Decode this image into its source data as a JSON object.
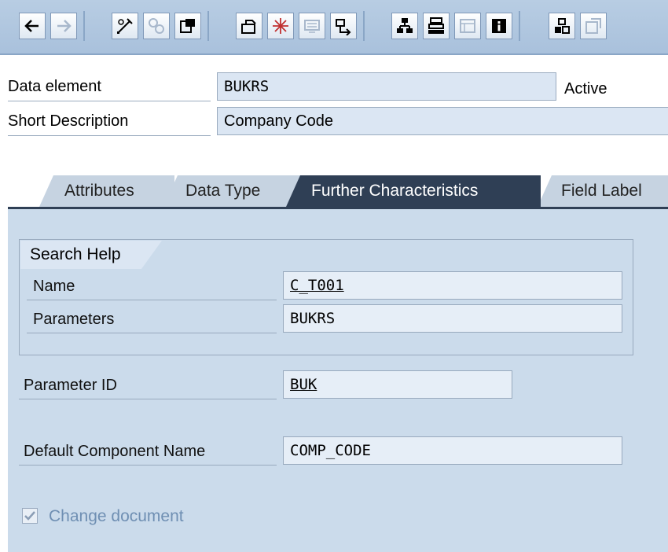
{
  "toolbar": {
    "buttons": [
      {
        "icon": "back-arrow-icon",
        "enabled": true
      },
      {
        "icon": "forward-arrow-icon",
        "enabled": false
      },
      {
        "icon": "display-change-icon",
        "enabled": true
      },
      {
        "icon": "active-inactive-icon",
        "enabled": false
      },
      {
        "icon": "other-object-icon",
        "enabled": true
      },
      {
        "icon": "check-icon",
        "enabled": true
      },
      {
        "icon": "activate-icon",
        "enabled": true
      },
      {
        "icon": "test-icon",
        "enabled": false
      },
      {
        "icon": "where-used-icon",
        "enabled": true
      },
      {
        "icon": "object-list-icon",
        "enabled": true
      },
      {
        "icon": "navigation-window-icon",
        "enabled": true
      },
      {
        "icon": "worklist-icon",
        "enabled": false
      },
      {
        "icon": "info-icon",
        "enabled": true
      },
      {
        "icon": "hierarchy-icon",
        "enabled": true
      },
      {
        "icon": "settings-icon",
        "enabled": false
      }
    ]
  },
  "header": {
    "data_element_label": "Data element",
    "data_element_value": "BUKRS",
    "status": "Active",
    "short_desc_label": "Short Description",
    "short_desc_value": "Company Code"
  },
  "tabs": [
    {
      "label": "Attributes",
      "active": false
    },
    {
      "label": "Data Type",
      "active": false
    },
    {
      "label": "Further Characteristics",
      "active": true
    },
    {
      "label": "Field Label",
      "active": false
    }
  ],
  "search_help": {
    "title": "Search Help",
    "name_label": "Name",
    "name_value": "C_T001",
    "parameters_label": "Parameters",
    "parameters_value": "BUKRS"
  },
  "parameter_id": {
    "label": "Parameter ID",
    "value": "BUK"
  },
  "default_component": {
    "label": "Default Component Name",
    "value": "COMP_CODE"
  },
  "change_document": {
    "label": "Change document",
    "checked": true,
    "enabled": false
  },
  "colors": {
    "active_tab": "#2f3f55",
    "panel": "#cbdbeb",
    "field": "#e6eef7",
    "disabled_text": "#6f8fb3"
  }
}
